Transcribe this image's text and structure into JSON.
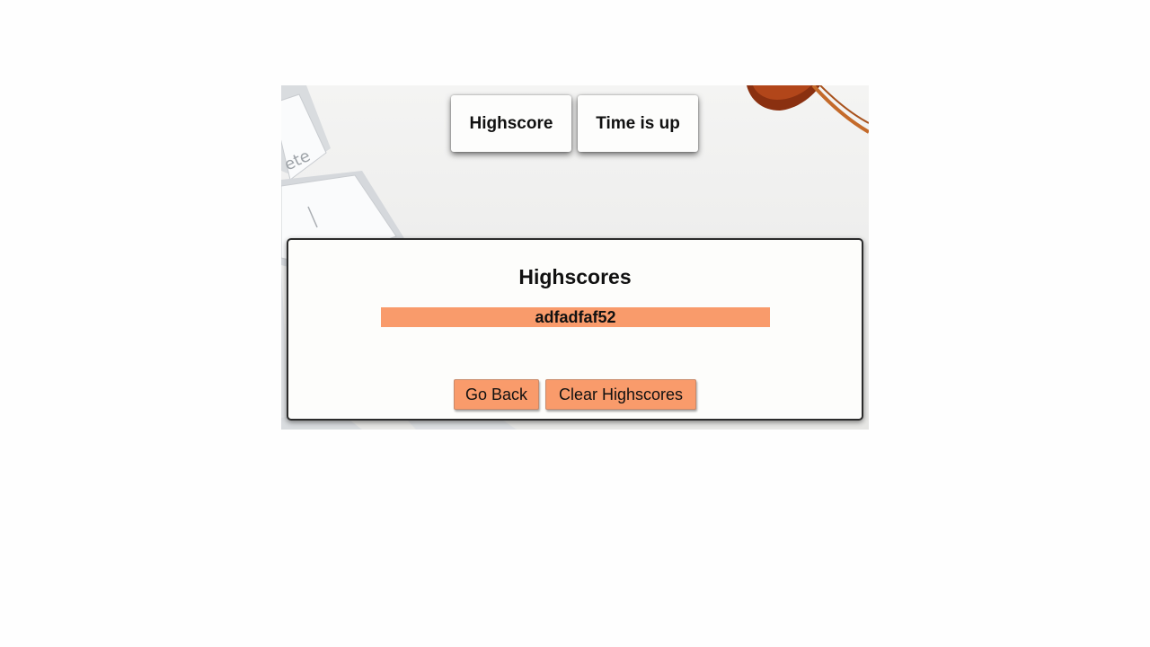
{
  "nav": {
    "highscore_label": "Highscore",
    "timer_label": "Time is up"
  },
  "highscores": {
    "title": "Highscores",
    "entries": [
      "adfadfaf52"
    ]
  },
  "actions": {
    "go_back_label": "Go Back",
    "clear_label": "Clear Highscores"
  },
  "colors": {
    "accent": "#f99b6b",
    "panel_bg": "#fdfdfb"
  }
}
